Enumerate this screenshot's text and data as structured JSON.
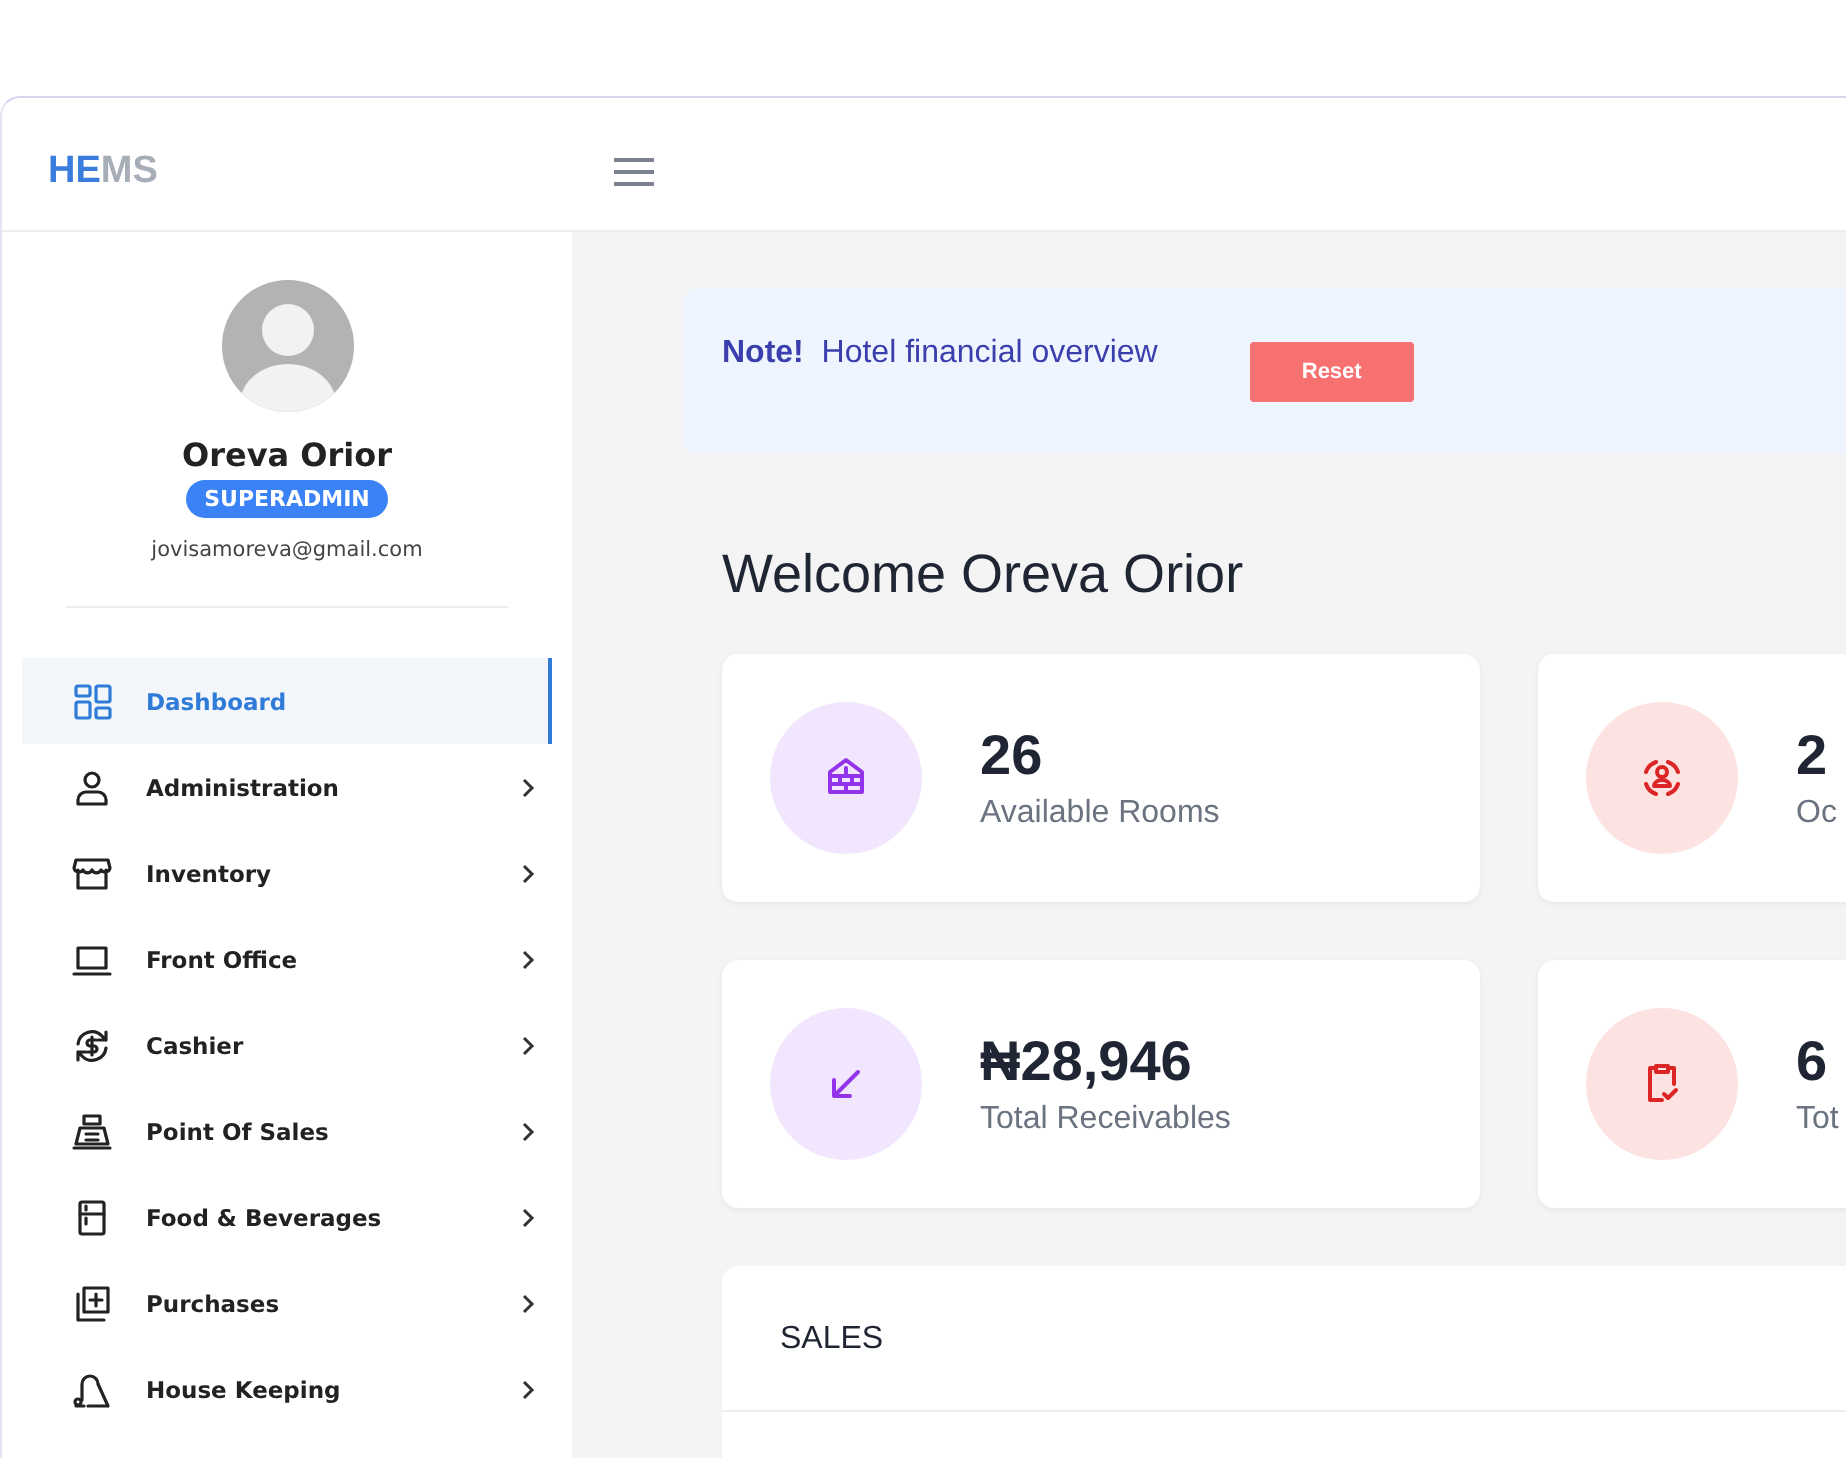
{
  "logo": {
    "primary": "HE",
    "secondary": "MS"
  },
  "profile": {
    "name": "Oreva Orior",
    "role": "SUPERADMIN",
    "email": "jovisamoreva@gmail.com"
  },
  "sidebar": {
    "items": [
      {
        "label": "Dashboard",
        "selected": true,
        "submenu": false
      },
      {
        "label": "Administration",
        "selected": false,
        "submenu": true
      },
      {
        "label": "Inventory",
        "selected": false,
        "submenu": true
      },
      {
        "label": "Front Office",
        "selected": false,
        "submenu": true
      },
      {
        "label": "Cashier",
        "selected": false,
        "submenu": true
      },
      {
        "label": "Point Of Sales",
        "selected": false,
        "submenu": true
      },
      {
        "label": "Food & Beverages",
        "selected": false,
        "submenu": true
      },
      {
        "label": "Purchases",
        "selected": false,
        "submenu": true
      },
      {
        "label": "House Keeping",
        "selected": false,
        "submenu": true
      }
    ]
  },
  "note": {
    "label": "Note!",
    "text": "Hotel financial overview",
    "button": "Reset"
  },
  "welcome": "Welcome Oreva Orior",
  "stats": [
    {
      "value": "26",
      "label": "Available Rooms"
    },
    {
      "value": "2",
      "label": "Oc"
    },
    {
      "value": "₦28,946",
      "label": "Total Receivables"
    },
    {
      "value": "6",
      "label": "Tot"
    }
  ],
  "sales": {
    "title": "SALES"
  }
}
